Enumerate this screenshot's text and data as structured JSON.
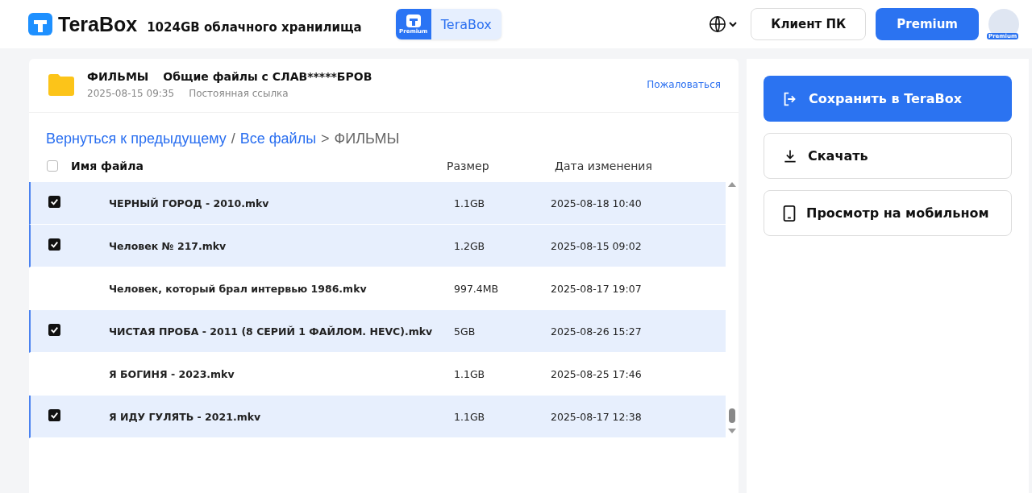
{
  "header": {
    "logo_text": "TeraBox",
    "storage": "1024GB облачного хранилища",
    "premium_badge": "Premium",
    "premium_tab": "TeraBox",
    "client_button": "Клиент ПК",
    "premium_button": "Premium",
    "avatar_badge": "Premium"
  },
  "share": {
    "folder": "ФИЛЬМЫ",
    "title": "Общие файлы с СЛАВ*****БРОВ",
    "date": "2025-08-15 09:35",
    "link_type": "Постоянная ссылка",
    "report": "Пожаловаться"
  },
  "breadcrumb": [
    {
      "kind": "link",
      "label": "Вернуться к предыдущему"
    },
    {
      "kind": "sep",
      "label": "/"
    },
    {
      "kind": "link",
      "label": "Все файлы"
    },
    {
      "kind": "sep",
      "label": ">"
    },
    {
      "kind": "current",
      "label": "ФИЛЬМЫ"
    }
  ],
  "table": {
    "columns": [
      "Имя файла",
      "Размер",
      "Дата изменения"
    ],
    "all_checked": false,
    "rows": [
      {
        "name": "ЧЕРНЫЙ ГОРОД - 2010.mkv",
        "size": "1.1GB",
        "date": "2025-08-18 10:40",
        "selected": true
      },
      {
        "name": "Человек № 217.mkv",
        "size": "1.2GB",
        "date": "2025-08-15 09:02",
        "selected": true
      },
      {
        "name": "Человек, который брал интервью 1986.mkv",
        "size": "997.4MB",
        "date": "2025-08-17 19:07",
        "selected": false
      },
      {
        "name": "ЧИСТАЯ ПРОБА - 2011 (8 СЕРИЙ 1 ФАЙЛОМ. HEVC).mkv",
        "size": "5GB",
        "date": "2025-08-26 15:27",
        "selected": true
      },
      {
        "name": "Я БОГИНЯ - 2023.mkv",
        "size": "1.1GB",
        "date": "2025-08-25 17:46",
        "selected": false
      },
      {
        "name": "Я ИДУ ГУЛЯТЬ - 2021.mkv",
        "size": "1.1GB",
        "date": "2025-08-17 12:38",
        "selected": true
      }
    ]
  },
  "actions": [
    {
      "kind": "primary",
      "label": "Сохранить в TeraBox"
    },
    {
      "kind": "outline",
      "label": "Скачать"
    },
    {
      "kind": "outline",
      "label": "Просмотр на мобильном"
    }
  ]
}
